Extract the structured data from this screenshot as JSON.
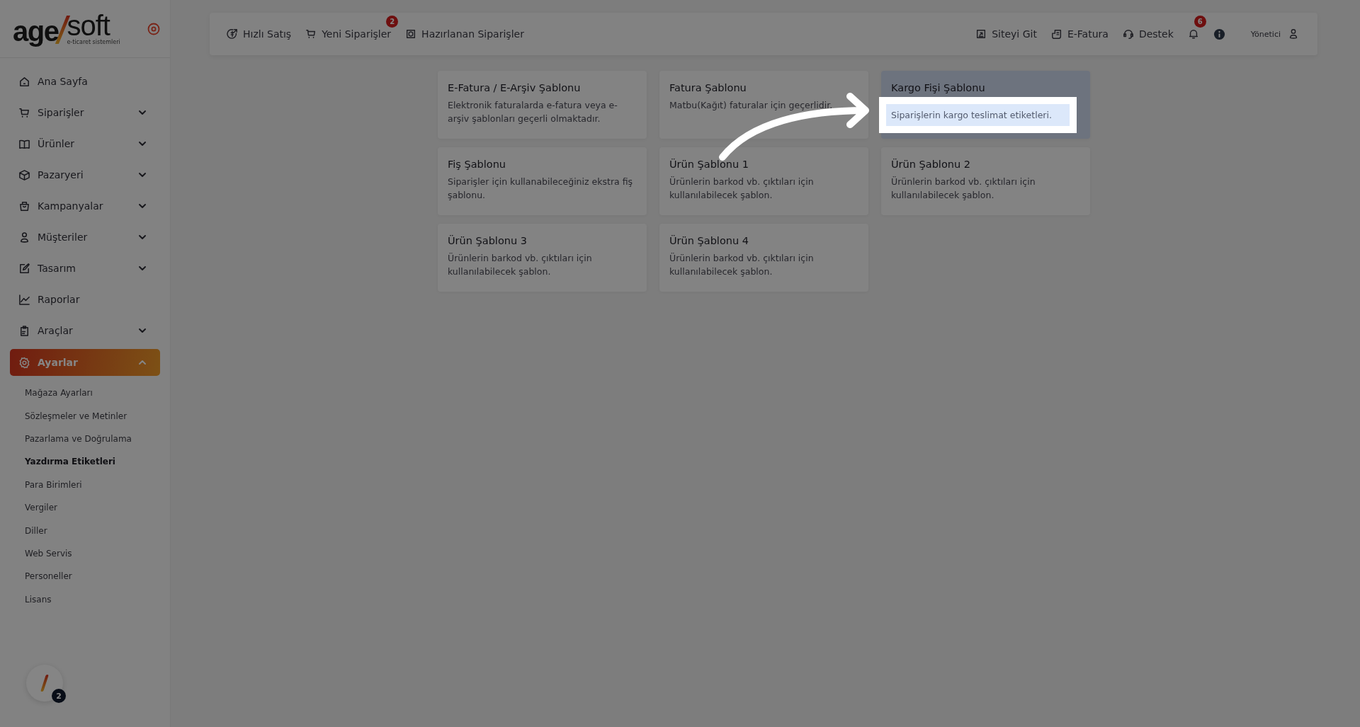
{
  "sidebar": {
    "brand": {
      "main": "age",
      "accent": "soft",
      "tagline": "e-ticaret sistemleri"
    },
    "items": [
      {
        "label": "Ana Sayfa",
        "kind": "link",
        "selected": false
      },
      {
        "label": "Siparişler",
        "kind": "group",
        "expanded": false,
        "selected": false
      },
      {
        "label": "Ürünler",
        "kind": "group",
        "expanded": false,
        "selected": false
      },
      {
        "label": "Pazaryeri",
        "kind": "group",
        "expanded": false,
        "selected": false
      },
      {
        "label": "Kampanyalar",
        "kind": "group",
        "expanded": false,
        "selected": false
      },
      {
        "label": "Müşteriler",
        "kind": "group",
        "expanded": false,
        "selected": false
      },
      {
        "label": "Tasarım",
        "kind": "group",
        "expanded": false,
        "selected": false
      },
      {
        "label": "Raporlar",
        "kind": "link",
        "selected": false
      },
      {
        "label": "Araçlar",
        "kind": "group",
        "expanded": false,
        "selected": false
      },
      {
        "label": "Ayarlar",
        "kind": "group",
        "expanded": true,
        "selected": true,
        "children": [
          {
            "label": "Mağaza Ayarları",
            "selected": false
          },
          {
            "label": "Sözleşmeler ve Metinler",
            "selected": false
          },
          {
            "label": "Pazarlama ve Doğrulama",
            "selected": false
          },
          {
            "label": "Yazdırma Etiketleri",
            "selected": true
          },
          {
            "label": "Para Birimleri",
            "selected": false
          },
          {
            "label": "Vergiler",
            "selected": false
          },
          {
            "label": "Diller",
            "selected": false
          },
          {
            "label": "Web Servis",
            "selected": false
          },
          {
            "label": "Personeller",
            "selected": false
          },
          {
            "label": "Lisans",
            "selected": false
          }
        ]
      }
    ],
    "assistant": {
      "badge": "2"
    }
  },
  "topbar": {
    "left": [
      {
        "label": "Hızlı Satış"
      },
      {
        "label": "Yeni Siparişler",
        "badge": "2"
      },
      {
        "label": "Hazırlanan Siparişler"
      }
    ],
    "right": [
      {
        "label": "Siteyi Git"
      },
      {
        "label": "E-Fatura"
      },
      {
        "label": "Destek"
      }
    ],
    "notifications": {
      "badge": "6"
    },
    "user": {
      "label": "Yönetici"
    }
  },
  "templates": [
    {
      "title": "E-Fatura / E-Arşiv Şablonu",
      "description": "Elektronik faturalarda e-fatura veya e-arşiv şablonları geçerli olmaktadır.",
      "highlighted": false
    },
    {
      "title": "Fatura Şablonu",
      "description": "Matbu(Kağıt) faturalar için geçerlidir.",
      "highlighted": false
    },
    {
      "title": "Kargo Fişi Şablonu",
      "description": "Siparişlerin kargo teslimat etiketleri.",
      "highlighted": true
    },
    {
      "title": "Fiş Şablonu",
      "description": "Siparişler için kullanabileceğiniz ekstra fiş şablonu.",
      "highlighted": false
    },
    {
      "title": "Ürün Şablonu 1",
      "description": "Ürünlerin barkod vb. çıktıları için kullanılabilecek şablon.",
      "highlighted": false
    },
    {
      "title": "Ürün Şablonu 2",
      "description": "Ürünlerin barkod vb. çıktıları için kullanılabilecek şablon.",
      "highlighted": false
    },
    {
      "title": "Ürün Şablonu 3",
      "description": "Ürünlerin barkod vb. çıktıları için kullanılabilecek şablon.",
      "highlighted": false
    },
    {
      "title": "Ürün Şablonu 4",
      "description": "Ürünlerin barkod vb. çıktıları için kullanılabilecek şablon.",
      "highlighted": false
    }
  ],
  "tour": {
    "dimmed": true
  }
}
